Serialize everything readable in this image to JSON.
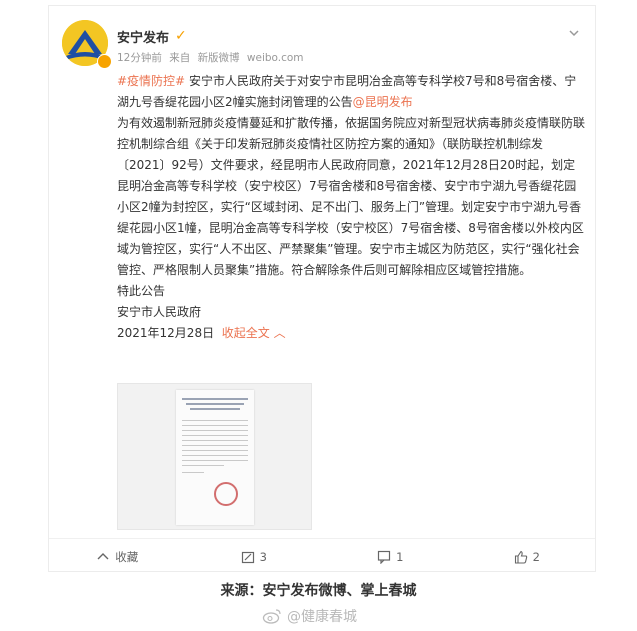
{
  "post": {
    "username": "安宁发布",
    "verified_icon": "verified-v-icon",
    "meta": {
      "time": "12分钟前",
      "via_prefix": "来自",
      "client": "新版微博",
      "site": "weibo.com"
    },
    "hashtag": "#疫情防控#",
    "title_text": " 安宁市人民政府关于对安宁市昆明冶金高等专科学校7号和8号宿舍楼、宁湖九号香缇花园小区2幢实施封闭管理的公告",
    "mention": "@昆明发布",
    "body": "为有效遏制新冠肺炎疫情蔓延和扩散传播，依据国务院应对新型冠状病毒肺炎疫情联防联控机制综合组《关于印发新冠肺炎疫情社区防控方案的通知》（联防联控机制综发〔2021〕92号）文件要求，经昆明市人民政府同意，2021年12月28日20时起，划定昆明冶金高等专科学校（安宁校区）7号宿舍楼和8号宿舍楼、安宁市宁湖九号香缇花园小区2幢为封控区，实行“区域封闭、足不出门、服务上门”管理。划定安宁市宁湖九号香缇花园小区1幢，昆明冶金高等专科学校（安宁校区）7号宿舍楼、8号宿舍楼以外校内区域为管控区，实行“人不出区、严禁聚集”管理。安宁市主城区为防范区，实行“强化社会管控、严格限制人员聚集”措施。符合解除条件后则可解除相应区域管控措施。",
    "closing": "特此公告",
    "issuer": "安宁市人民政府",
    "date": "2021年12月28日",
    "collapse_label": "收起全文"
  },
  "actions": {
    "favorite_label": "收藏",
    "repost_count": "3",
    "comment_count": "1",
    "like_count": "2"
  },
  "footer": {
    "source": "来源：安宁发布微博、掌上春城",
    "watermark": "@健康春城"
  },
  "colors": {
    "accent": "#eb7350",
    "verified": "#f6a000",
    "text": "#333333",
    "muted": "#999999"
  }
}
